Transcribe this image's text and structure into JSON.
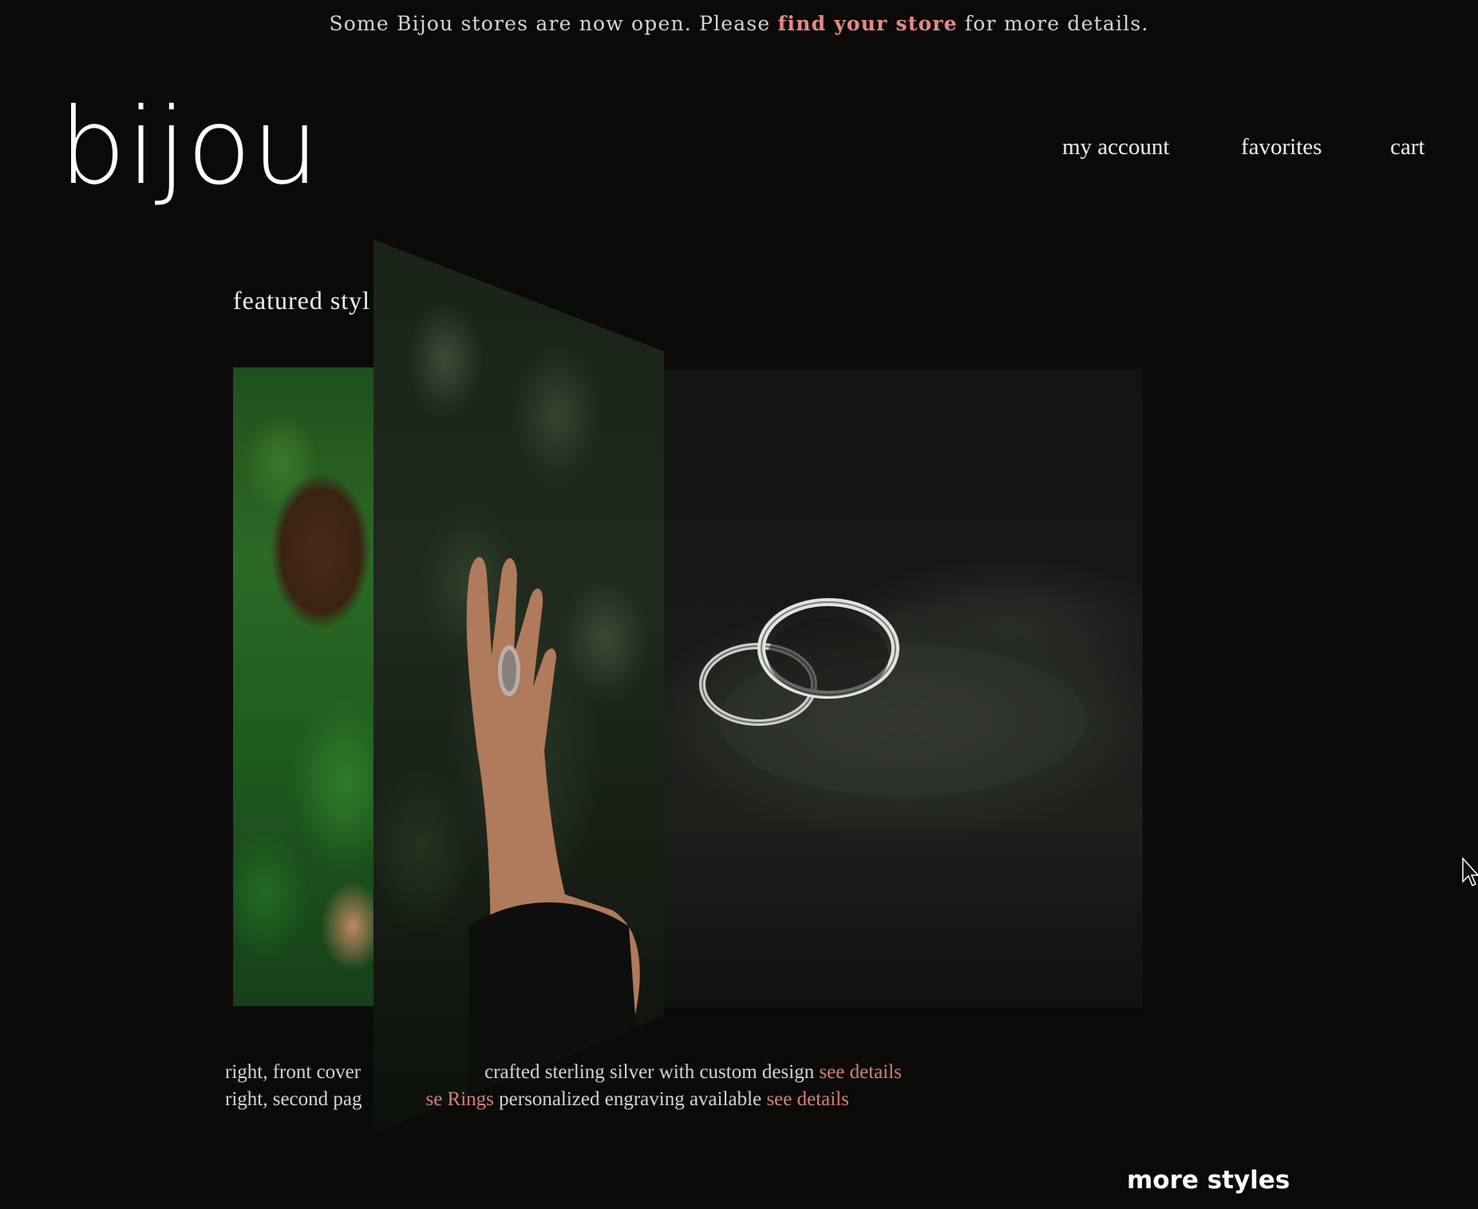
{
  "announcement": {
    "before": "Some Bijou stores are now open. Please ",
    "link": "find your store",
    "after": " for more details."
  },
  "header": {
    "logo": "bijou",
    "nav": [
      "my account",
      "favorites",
      "cart"
    ]
  },
  "featured": {
    "title": "featured styl"
  },
  "captions": [
    {
      "prefix": "right, front cover",
      "middle": "crafted sterling silver with custom design ",
      "link": "see details"
    },
    {
      "prefix": "right, second pag",
      "name": "se Rings",
      "middle": " personalized engraving available ",
      "link": "see details"
    }
  ],
  "more_styles": "more styles",
  "colors": {
    "background": "#0b0a09",
    "accent_link": "#e58a86",
    "text": "#e8e3dc"
  }
}
